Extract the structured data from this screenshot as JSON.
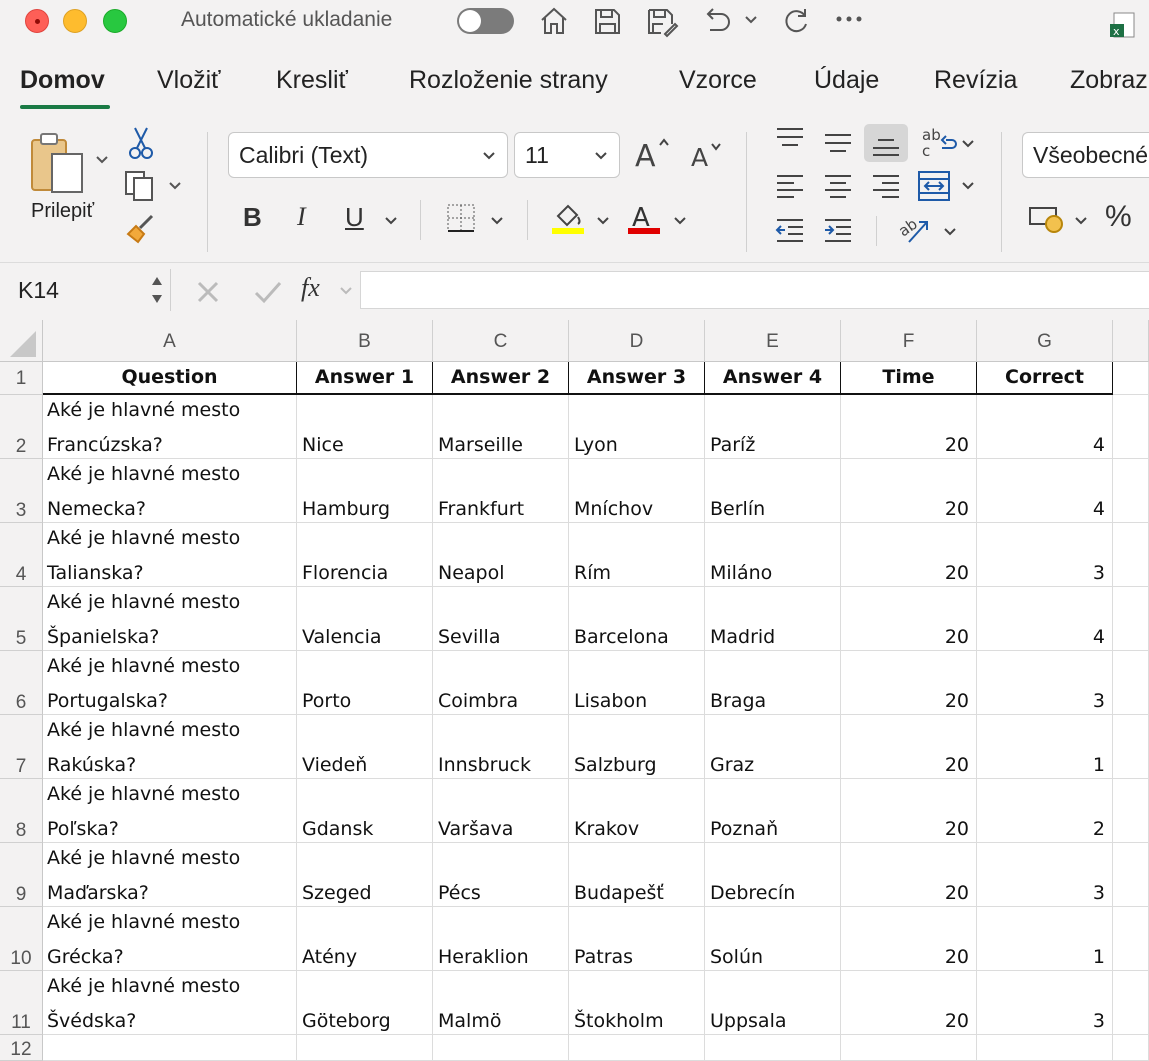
{
  "titlebar": {
    "autosave_label": "Automatické ukladanie"
  },
  "tabs": [
    "Domov",
    "Vložiť",
    "Kresliť",
    "Rozloženie strany",
    "Vzorce",
    "Údaje",
    "Revízia",
    "Zobraz"
  ],
  "ribbon": {
    "paste_label": "Prilepiť",
    "font_name": "Calibri (Text)",
    "font_size": "11",
    "number_format": "Všeobecné",
    "bold": "B",
    "italic": "I",
    "underline": "U",
    "percent": "%",
    "fill_color": "#ffff00",
    "font_color": "#e00000"
  },
  "formula_bar": {
    "name_box": "K14",
    "fx": "fx",
    "value": ""
  },
  "grid": {
    "columns": [
      "A",
      "B",
      "C",
      "D",
      "E",
      "F",
      "G"
    ],
    "row_numbers": [
      "1",
      "2",
      "3",
      "4",
      "5",
      "6",
      "7",
      "8",
      "9",
      "10",
      "11",
      "12"
    ],
    "header": [
      "Question",
      "Answer 1",
      "Answer 2",
      "Answer 3",
      "Answer 4",
      "Time",
      "Correct"
    ],
    "rows": [
      {
        "q1": "Aké je hlavné mesto",
        "q2": "Francúzska?",
        "a1": "Nice",
        "a2": "Marseille",
        "a3": "Lyon",
        "a4": "Paríž",
        "time": "20",
        "correct": "4"
      },
      {
        "q1": "Aké je hlavné mesto",
        "q2": "Nemecka?",
        "a1": "Hamburg",
        "a2": "Frankfurt",
        "a3": "Mníchov",
        "a4": "Berlín",
        "time": "20",
        "correct": "4"
      },
      {
        "q1": "Aké je hlavné mesto",
        "q2": "Talianska?",
        "a1": "Florencia",
        "a2": "Neapol",
        "a3": "Rím",
        "a4": "Miláno",
        "time": "20",
        "correct": "3"
      },
      {
        "q1": "Aké je hlavné mesto",
        "q2": "Španielska?",
        "a1": "Valencia",
        "a2": "Sevilla",
        "a3": "Barcelona",
        "a4": "Madrid",
        "time": "20",
        "correct": "4"
      },
      {
        "q1": "Aké je hlavné mesto",
        "q2": "Portugalska?",
        "a1": "Porto",
        "a2": "Coimbra",
        "a3": "Lisabon",
        "a4": "Braga",
        "time": "20",
        "correct": "3"
      },
      {
        "q1": "Aké je hlavné mesto",
        "q2": "Rakúska?",
        "a1": "Viedeň",
        "a2": "Innsbruck",
        "a3": "Salzburg",
        "a4": "Graz",
        "time": "20",
        "correct": "1"
      },
      {
        "q1": "Aké je hlavné mesto",
        "q2": "Poľska?",
        "a1": "Gdansk",
        "a2": "Varšava",
        "a3": "Krakov",
        "a4": "Poznaň",
        "time": "20",
        "correct": "2"
      },
      {
        "q1": "Aké je hlavné mesto",
        "q2": "Maďarska?",
        "a1": "Szeged",
        "a2": "Pécs",
        "a3": "Budapešť",
        "a4": "Debrecín",
        "time": "20",
        "correct": "3"
      },
      {
        "q1": "Aké je hlavné mesto",
        "q2": "Grécka?",
        "a1": "Atény",
        "a2": "Heraklion",
        "a3": "Patras",
        "a4": "Solún",
        "time": "20",
        "correct": "1"
      },
      {
        "q1": "Aké je hlavné mesto",
        "q2": "Švédska?",
        "a1": "Göteborg",
        "a2": "Malmö",
        "a3": "Štokholm",
        "a4": "Uppsala",
        "time": "20",
        "correct": "3"
      }
    ]
  }
}
